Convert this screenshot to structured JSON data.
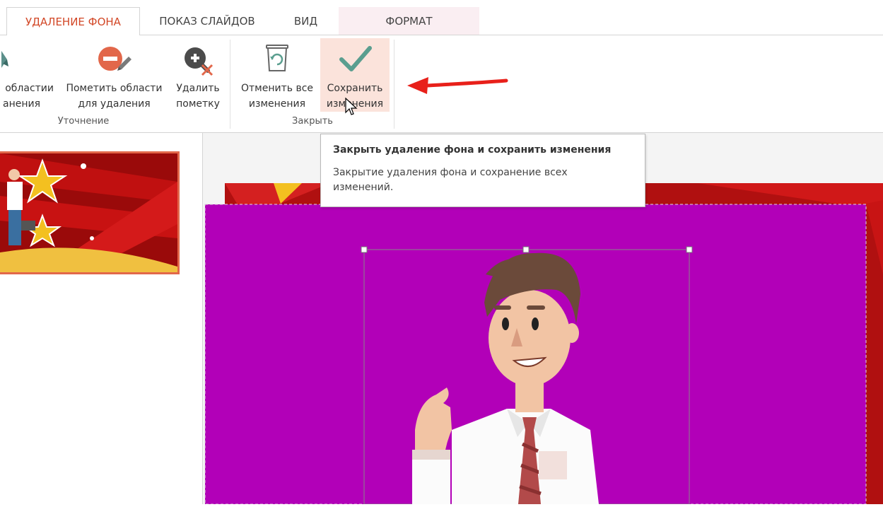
{
  "tabs": [
    {
      "label": "УДАЛЕНИЕ ФОНА",
      "active": true
    },
    {
      "label": "ПОКАЗ СЛАЙДОВ",
      "active": false
    },
    {
      "label": "ВИД",
      "active": false
    },
    {
      "label": "ФОРМАТ",
      "active": false
    }
  ],
  "ribbon": {
    "refine_group": {
      "label": "Уточнение",
      "mark_keep": {
        "line1": "областии",
        "line2": "анения",
        "icon": "pencil-plus-icon"
      },
      "mark_remove": {
        "line1": "Пометить области",
        "line2": "для удаления",
        "icon": "remove-area-icon"
      },
      "delete_mark": {
        "line1": "Удалить",
        "line2": "пометку",
        "icon": "delete-mark-icon"
      }
    },
    "close_group": {
      "label": "Закрыть",
      "discard": {
        "line1": "Отменить все",
        "line2": "изменения",
        "icon": "recycle-bin-icon"
      },
      "keep": {
        "line1": "Сохранить",
        "line2": "изменения",
        "icon": "checkmark-icon"
      }
    }
  },
  "tooltip": {
    "title": "Закрыть удаление фона и сохранить изменения",
    "body": "Закрытие удаления фона и сохранение всех изменений."
  },
  "colors": {
    "accent": "#d24726",
    "removal_magenta": "#b200b8",
    "checkmark": "#5a9e8f",
    "arrow": "#e8201a"
  }
}
